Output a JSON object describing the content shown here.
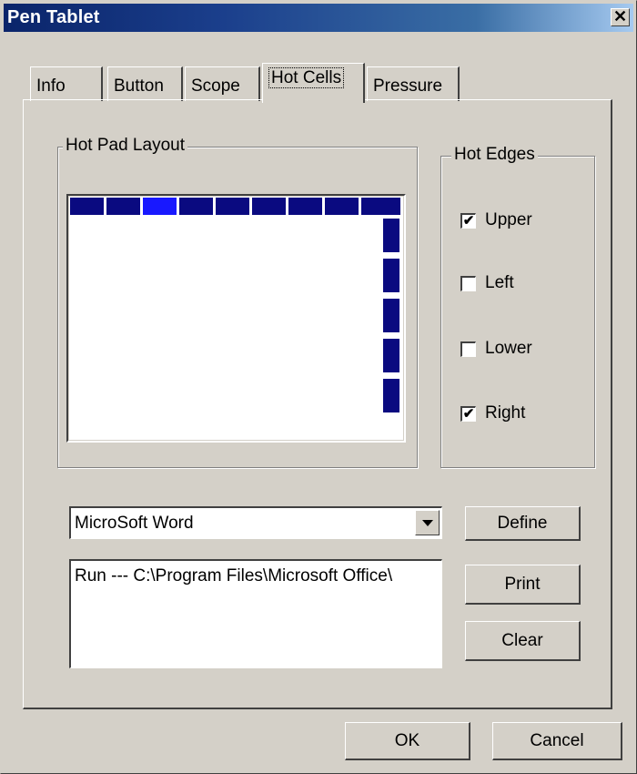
{
  "window": {
    "title": "Pen Tablet"
  },
  "tabs": [
    {
      "label": "Info"
    },
    {
      "label": "Button"
    },
    {
      "label": "Scope"
    },
    {
      "label": "Hot Cells"
    },
    {
      "label": "Pressure"
    }
  ],
  "active_tab": "Hot Cells",
  "hot_pad_layout": {
    "label": "Hot Pad Layout",
    "top_cells": 9,
    "right_cells": 5,
    "selected_cell": "top-3"
  },
  "hot_edges": {
    "label": "Hot Edges",
    "upper": {
      "label": "Upper",
      "checked": true
    },
    "left": {
      "label": "Left",
      "checked": false
    },
    "lower": {
      "label": "Lower",
      "checked": false
    },
    "right": {
      "label": "Right",
      "checked": true
    }
  },
  "application": {
    "selected": "MicroSoft Word"
  },
  "action_list": [
    "Run --- C:\\Program Files\\Microsoft Office\\"
  ],
  "buttons": {
    "define": "Define",
    "print": "Print",
    "clear": "Clear",
    "ok": "OK",
    "cancel": "Cancel"
  },
  "colors": {
    "cell": "#0a0a80",
    "cell_selected": "#1818ff",
    "title_start": "#0a246a",
    "title_end": "#a6caf0",
    "face": "#d4d0c8"
  }
}
